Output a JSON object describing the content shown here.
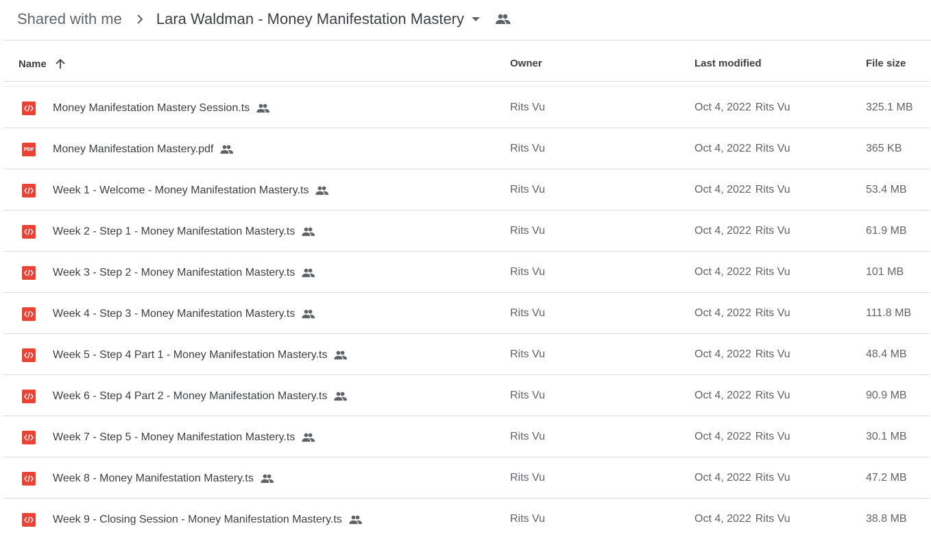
{
  "breadcrumb": {
    "parent": "Shared with me",
    "current": "Lara Waldman - Money Manifestation Mastery"
  },
  "columns": {
    "name": "Name",
    "owner": "Owner",
    "last_modified": "Last modified",
    "file_size": "File size"
  },
  "icons": {
    "separator": "chevron-right-icon",
    "dropdown": "arrow-drop-down-icon",
    "shared": "people-icon",
    "sort": "arrow-upward-icon",
    "code_file": "code-file-icon",
    "pdf_file": "pdf-file-icon"
  },
  "colors": {
    "file_icon_red": "#ea4335",
    "text_primary": "#3c4043",
    "text_secondary": "#5f6368",
    "divider": "#dadce0"
  },
  "files": [
    {
      "type": "ts",
      "name": "Money Manifestation Mastery Session.ts",
      "owner": "Rits Vu",
      "modified_date": "Oct 4, 2022",
      "modified_by": "Rits Vu",
      "size": "325.1 MB"
    },
    {
      "type": "pdf",
      "icon_label": "PDF",
      "name": "Money Manifestation Mastery.pdf",
      "owner": "Rits Vu",
      "modified_date": "Oct 4, 2022",
      "modified_by": "Rits Vu",
      "size": "365 KB"
    },
    {
      "type": "ts",
      "name": "Week 1 - Welcome - Money Manifestation Mastery.ts",
      "owner": "Rits Vu",
      "modified_date": "Oct 4, 2022",
      "modified_by": "Rits Vu",
      "size": "53.4 MB"
    },
    {
      "type": "ts",
      "name": "Week 2 - Step 1 - Money Manifestation Mastery.ts",
      "owner": "Rits Vu",
      "modified_date": "Oct 4, 2022",
      "modified_by": "Rits Vu",
      "size": "61.9 MB"
    },
    {
      "type": "ts",
      "name": "Week 3 - Step 2 - Money Manifestation Mastery.ts",
      "owner": "Rits Vu",
      "modified_date": "Oct 4, 2022",
      "modified_by": "Rits Vu",
      "size": "101 MB"
    },
    {
      "type": "ts",
      "name": "Week 4 - Step 3 - Money Manifestation Mastery.ts",
      "owner": "Rits Vu",
      "modified_date": "Oct 4, 2022",
      "modified_by": "Rits Vu",
      "size": "111.8 MB"
    },
    {
      "type": "ts",
      "name": "Week 5 - Step 4 Part 1 - Money Manifestation Mastery.ts",
      "owner": "Rits Vu",
      "modified_date": "Oct 4, 2022",
      "modified_by": "Rits Vu",
      "size": "48.4 MB"
    },
    {
      "type": "ts",
      "name": "Week 6 - Step 4 Part 2 - Money Manifestation Mastery.ts",
      "owner": "Rits Vu",
      "modified_date": "Oct 4, 2022",
      "modified_by": "Rits Vu",
      "size": "90.9 MB"
    },
    {
      "type": "ts",
      "name": "Week 7 - Step 5 - Money Manifestation Mastery.ts",
      "owner": "Rits Vu",
      "modified_date": "Oct 4, 2022",
      "modified_by": "Rits Vu",
      "size": "30.1 MB"
    },
    {
      "type": "ts",
      "name": "Week 8 - Money Manifestation Mastery.ts",
      "owner": "Rits Vu",
      "modified_date": "Oct 4, 2022",
      "modified_by": "Rits Vu",
      "size": "47.2 MB"
    },
    {
      "type": "ts",
      "name": "Week 9 - Closing Session - Money Manifestation Mastery.ts",
      "owner": "Rits Vu",
      "modified_date": "Oct 4, 2022",
      "modified_by": "Rits Vu",
      "size": "38.8 MB"
    }
  ]
}
